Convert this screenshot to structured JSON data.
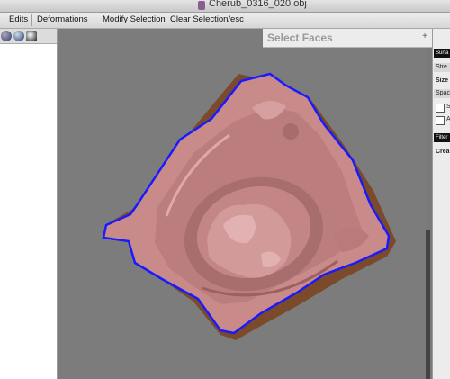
{
  "window": {
    "title": "Cherub_0316_020.obj"
  },
  "menu": {
    "edits": "Edits",
    "deformations": "Deformations",
    "modify_selection": "Modify Selection",
    "clear_selection": "Clear Selection/esc"
  },
  "select_panel": {
    "title": "Select Faces",
    "expand_symbol": "+"
  },
  "right_panel": {
    "surface_header": "Surfa",
    "strength_label": "Stre",
    "size_label": "Size",
    "spacing_label": "Spac",
    "checkbox_1_label": "S",
    "checkbox_2_label": "A",
    "filter_header": "Filter",
    "create_label": "Crea"
  },
  "colors": {
    "model": "#c98a8a",
    "selection_outline": "#1a1aff",
    "viewport_bg": "#7c7c7c"
  }
}
